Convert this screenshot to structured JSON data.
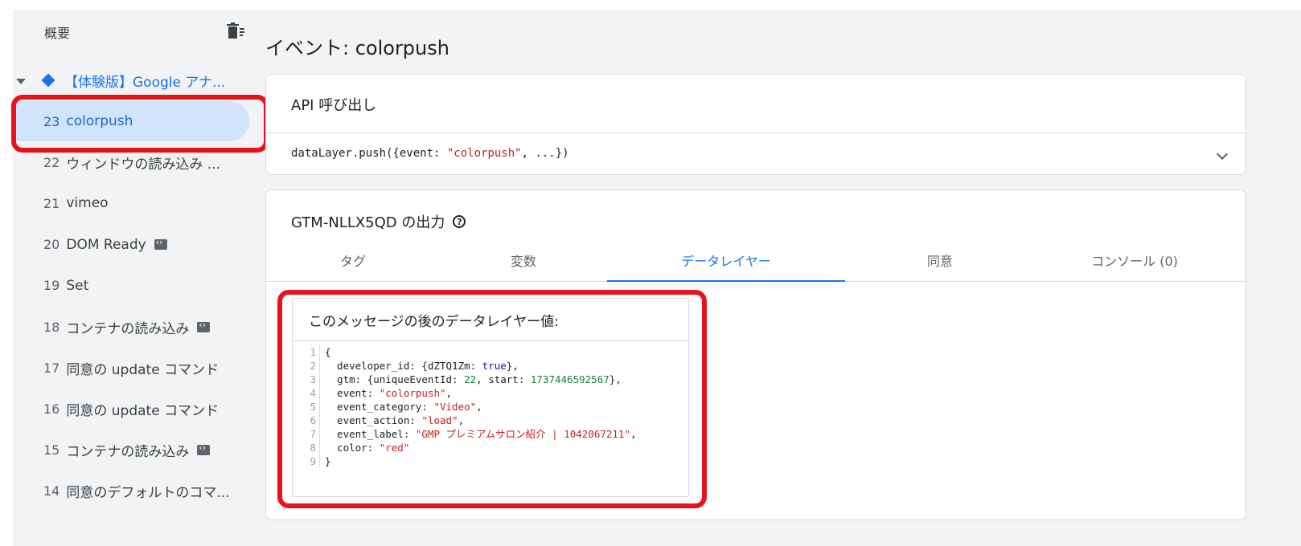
{
  "sidebar": {
    "summary_label": "概要",
    "container_label": "【体験版】Google アナ...",
    "items": [
      {
        "num": "23",
        "label": "colorpush",
        "selected": true,
        "has_icon": false
      },
      {
        "num": "22",
        "label": "ウィンドウの読み込み ...",
        "selected": false,
        "has_icon": false
      },
      {
        "num": "21",
        "label": "vimeo",
        "selected": false,
        "has_icon": false
      },
      {
        "num": "20",
        "label": "DOM Ready",
        "selected": false,
        "has_icon": true
      },
      {
        "num": "19",
        "label": "Set",
        "selected": false,
        "has_icon": false
      },
      {
        "num": "18",
        "label": "コンテナの読み込み",
        "selected": false,
        "has_icon": true
      },
      {
        "num": "17",
        "label": "同意の update コマンド",
        "selected": false,
        "has_icon": false
      },
      {
        "num": "16",
        "label": "同意の update コマンド",
        "selected": false,
        "has_icon": false
      },
      {
        "num": "15",
        "label": "コンテナの読み込み",
        "selected": false,
        "has_icon": true
      },
      {
        "num": "14",
        "label": "同意のデフォルトのコマ...",
        "selected": false,
        "has_icon": false
      }
    ]
  },
  "page": {
    "title": "イベント: colorpush"
  },
  "api_card": {
    "title": "API 呼び出し",
    "code_prefix": "dataLayer.push({event: ",
    "code_string": "\"colorpush\"",
    "code_suffix": ", ...})"
  },
  "gtm_card": {
    "title": "GTM-NLLX5QD の出力",
    "tabs": [
      "タグ",
      "変数",
      "データレイヤー",
      "同意",
      "コンソール (0)"
    ],
    "active_tab": 2
  },
  "datalayer": {
    "title": "このメッセージの後のデータレイヤー値:",
    "line_numbers": [
      "1",
      "2",
      "3",
      "4",
      "5",
      "6",
      "7",
      "8",
      "9"
    ],
    "lines": [
      [
        {
          "t": "{",
          "c": "plain"
        }
      ],
      [
        {
          "t": "  developer_id: {dZTQ1Zm: ",
          "c": "plain"
        },
        {
          "t": "true",
          "c": "bool"
        },
        {
          "t": "},",
          "c": "plain"
        }
      ],
      [
        {
          "t": "  gtm: {uniqueEventId: ",
          "c": "plain"
        },
        {
          "t": "22",
          "c": "num"
        },
        {
          "t": ", start: ",
          "c": "plain"
        },
        {
          "t": "1737446592567",
          "c": "num"
        },
        {
          "t": "},",
          "c": "plain"
        }
      ],
      [
        {
          "t": "  event: ",
          "c": "plain"
        },
        {
          "t": "\"colorpush\"",
          "c": "str"
        },
        {
          "t": ",",
          "c": "plain"
        }
      ],
      [
        {
          "t": "  event_category: ",
          "c": "plain"
        },
        {
          "t": "\"Video\"",
          "c": "str"
        },
        {
          "t": ",",
          "c": "plain"
        }
      ],
      [
        {
          "t": "  event_action: ",
          "c": "plain"
        },
        {
          "t": "\"load\"",
          "c": "str"
        },
        {
          "t": ",",
          "c": "plain"
        }
      ],
      [
        {
          "t": "  event_label: ",
          "c": "plain"
        },
        {
          "t": "\"GMP プレミアムサロン紹介 | 1042067211\"",
          "c": "str"
        },
        {
          "t": ",",
          "c": "plain"
        }
      ],
      [
        {
          "t": "  color: ",
          "c": "plain"
        },
        {
          "t": "\"red\"",
          "c": "str"
        }
      ],
      [
        {
          "t": "}",
          "c": "plain"
        }
      ]
    ]
  },
  "colors": {
    "accent": "#1a73e8",
    "highlight_box": "#e8121a",
    "string": "#c5221f",
    "number": "#188038"
  }
}
